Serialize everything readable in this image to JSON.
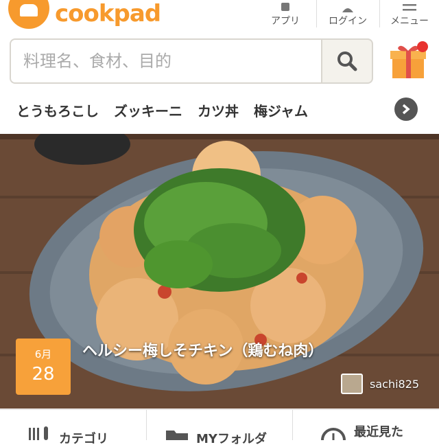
{
  "header": {
    "logo_text": "cookpad",
    "app_label": "アプリ",
    "login_label": "ログイン",
    "menu_label": "メニュー"
  },
  "search": {
    "placeholder": "料理名、食材、目的"
  },
  "keywords": [
    "とうもろこし",
    "ズッキーニ",
    "カツ丼",
    "梅ジャム"
  ],
  "hero": {
    "month": "6月",
    "day": "28",
    "title": "ヘルシー梅しそチキン（鶏むね肉）",
    "author": "sachi825"
  },
  "bottom_nav": {
    "category_label": "カテゴリ",
    "myfolder_label": "MYフォルダ",
    "recent_label": "最近見た"
  },
  "colors": {
    "brand": "#f79a2d",
    "badge": "#f7a13a"
  }
}
